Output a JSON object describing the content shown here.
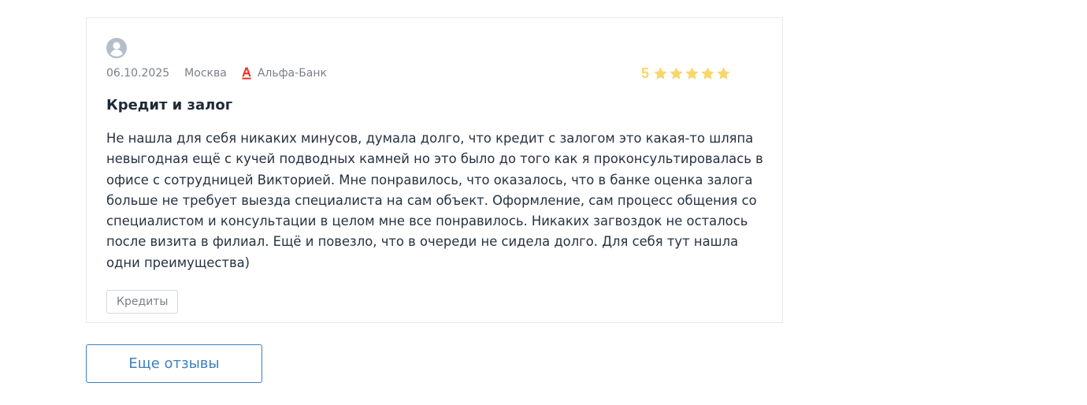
{
  "review": {
    "date": "06.10.2025",
    "city": "Москва",
    "bank": "Альфа-Банк",
    "rating": "5",
    "rating_stars": 5,
    "title": "Кредит и залог",
    "text": "Не нашла для себя никаких минусов, думала долго, что кредит с залогом это какая-то шляпа невыгодная ещё с кучей подводных камней но это было до того как я проконсультировалась в офисе с сотрудницей Викторией. Мне понравилось, что оказалось, что в банке оценка залога больше не требует выезда специалиста на сам объект. Оформление, сам процесс общения со специалистом и консультации в целом мне все понравилось. Никаких загвоздок не осталось после визита в филиал. Ещё и повезло, что в очереди не сидела долго. Для себя тут нашла одни преимущества)",
    "tag": "Кредиты"
  },
  "more_button": {
    "label": "Еще отзывы"
  },
  "colors": {
    "star": "#f8d66a",
    "bank_logo": "#ef3124",
    "button_accent": "#3f7fbf",
    "avatar": "#b5bec8"
  },
  "icons": {
    "avatar": "user-avatar-icon",
    "bank": "alfa-bank-logo-icon",
    "star": "star-icon"
  }
}
